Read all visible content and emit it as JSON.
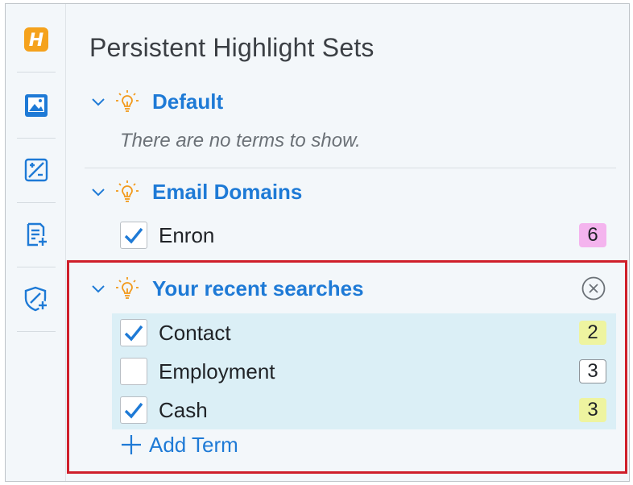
{
  "rail": {
    "items": [
      {
        "icon": "highlighter-logo-icon"
      },
      {
        "icon": "image-icon"
      },
      {
        "icon": "redaction-icon"
      },
      {
        "icon": "document-add-icon"
      },
      {
        "icon": "shield-add-icon"
      }
    ]
  },
  "panel": {
    "title": "Persistent Highlight Sets",
    "groups": [
      {
        "name": "Default",
        "empty_message": "There are no terms to show.",
        "terms": []
      },
      {
        "name": "Email Domains",
        "terms": [
          {
            "label": "Enron",
            "checked": true,
            "count": "6",
            "count_color": "#f4b4ee"
          }
        ]
      },
      {
        "name": "Your recent searches",
        "terms": [
          {
            "label": "Contact",
            "checked": true,
            "count": "2",
            "count_color": "#eef4a0"
          },
          {
            "label": "Employment",
            "checked": false,
            "count": "3",
            "count_color": "#ffffff"
          },
          {
            "label": "Cash",
            "checked": true,
            "count": "3",
            "count_color": "#eef4a0"
          }
        ],
        "add_term_label": "Add Term"
      }
    ]
  },
  "colors": {
    "accent": "#1e7ad6",
    "bulb": "#f29a1d",
    "highlight_box": "#cf1f2a",
    "row_highlight": "#dbeff6"
  }
}
